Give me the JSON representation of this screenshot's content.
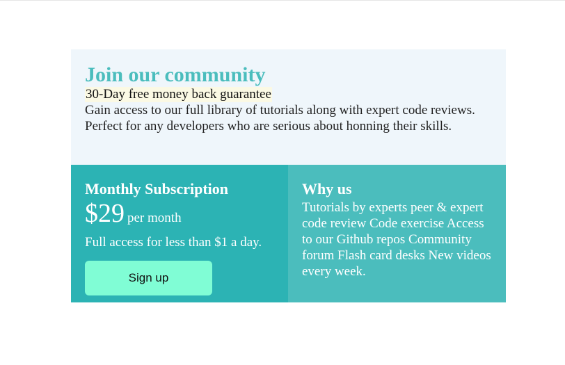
{
  "header": {
    "title": "Join our community",
    "guarantee": "30-Day free money back guarantee",
    "description": "Gain access to our full library of tutorials along with expert code reviews. Perfect for any developers who are serious about honning their skills."
  },
  "subscription": {
    "title": "Monthly Subscription",
    "price": "$29",
    "period": "per month",
    "access_text": "Full access for less than $1 a day.",
    "signup_label": "Sign up"
  },
  "why_us": {
    "title": "Why us",
    "text": "Tutorials by experts peer & expert code review Code exercise Access to our Github repos Community forum Flash card desks New videos every week."
  },
  "colors": {
    "accent": "#4bbdbd",
    "accent_dark": "#2cb3b4",
    "button": "#80fdd5",
    "top_background": "#eff6fb"
  }
}
